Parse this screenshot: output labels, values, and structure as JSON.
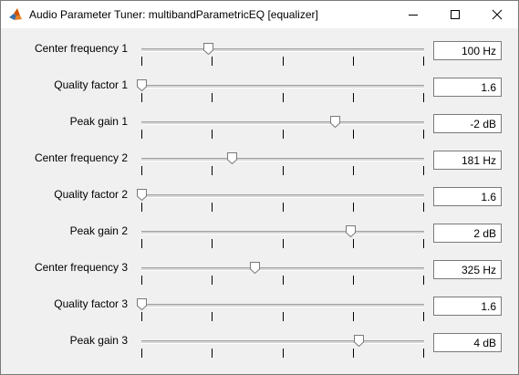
{
  "window": {
    "title": "Audio Parameter Tuner: multibandParametricEQ [equalizer]"
  },
  "icons": {
    "app": "matlab-icon",
    "minimize": "minimize-icon",
    "maximize": "maximize-icon",
    "close": "close-icon"
  },
  "parameters": [
    {
      "label": "Center frequency 1",
      "value": "100 Hz",
      "position": 0.235
    },
    {
      "label": "Quality factor 1",
      "value": "1.6",
      "position": 0.0
    },
    {
      "label": "Peak gain 1",
      "value": "-2 dB",
      "position": 0.685
    },
    {
      "label": "Center frequency 2",
      "value": "181 Hz",
      "position": 0.32
    },
    {
      "label": "Quality factor 2",
      "value": "1.6",
      "position": 0.0
    },
    {
      "label": "Peak gain 2",
      "value": "2 dB",
      "position": 0.74
    },
    {
      "label": "Center frequency 3",
      "value": "325 Hz",
      "position": 0.4
    },
    {
      "label": "Quality factor 3",
      "value": "1.6",
      "position": 0.0
    },
    {
      "label": "Peak gain 3",
      "value": "4 dB",
      "position": 0.77
    }
  ]
}
